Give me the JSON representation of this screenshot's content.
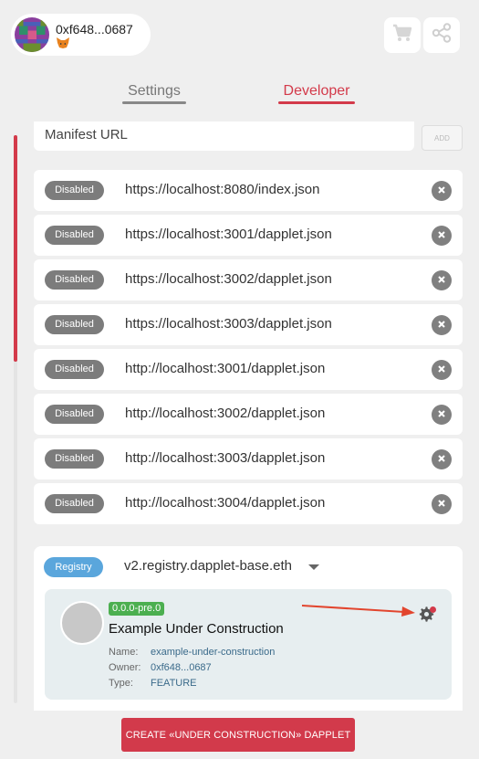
{
  "header": {
    "account_address": "0xf648...0687",
    "wallet_icon": "metamask-fox-icon",
    "cart_icon": "cart-icon",
    "share_icon": "share-icon"
  },
  "tabs": [
    {
      "label": "Settings",
      "active": false
    },
    {
      "label": "Developer",
      "active": true
    }
  ],
  "manifest": {
    "placeholder": "Manifest URL",
    "add_label": "ADD"
  },
  "registries": [
    {
      "status": "Disabled",
      "url": "https://localhost:8080/index.json"
    },
    {
      "status": "Disabled",
      "url": "https://localhost:3001/dapplet.json"
    },
    {
      "status": "Disabled",
      "url": "https://localhost:3002/dapplet.json"
    },
    {
      "status": "Disabled",
      "url": "https://localhost:3003/dapplet.json"
    },
    {
      "status": "Disabled",
      "url": "http://localhost:3001/dapplet.json"
    },
    {
      "status": "Disabled",
      "url": "http://localhost:3002/dapplet.json"
    },
    {
      "status": "Disabled",
      "url": "http://localhost:3003/dapplet.json"
    },
    {
      "status": "Disabled",
      "url": "http://localhost:3004/dapplet.json"
    }
  ],
  "registry_panel": {
    "badge": "Registry",
    "selected": "v2.registry.dapplet-base.eth"
  },
  "module": {
    "version": "0.0.0-pre.0",
    "title": "Example Under Construction",
    "name_label": "Name:",
    "name": "example-under-construction",
    "owner_label": "Owner:",
    "owner": "0xf648...0687",
    "type_label": "Type:",
    "type": "FEATURE"
  },
  "create_button": "CREATE «UNDER CONSTRUCTION» DAPPLET",
  "colors": {
    "accent": "#d33a4a",
    "disabled_badge": "#7c7c7c",
    "registry_badge": "#5aa6dc",
    "version_badge": "#4caf50"
  }
}
